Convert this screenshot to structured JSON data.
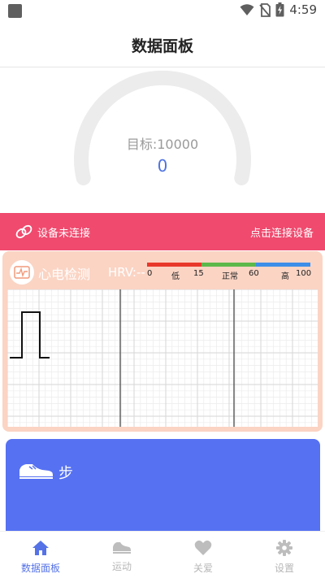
{
  "status_bar": {
    "time": "4:59"
  },
  "header": {
    "title": "数据面板"
  },
  "gauge": {
    "target_label": "目标:10000",
    "steps_value": "0",
    "progress": 0
  },
  "connect": {
    "status_text": "设备未连接",
    "action_text": "点击连接设备"
  },
  "ecg": {
    "title": "心电检测",
    "hrv_label": "HRV:--",
    "scale": [
      {
        "text": "0"
      },
      {
        "text": "低"
      },
      {
        "text": "15"
      },
      {
        "text": "正常"
      },
      {
        "text": "60"
      },
      {
        "text": "高"
      },
      {
        "text": "100"
      }
    ],
    "colors": {
      "low": "#e8382b",
      "normal": "#5cb84a",
      "high": "#3c8ee8"
    }
  },
  "steps_card": {
    "label": "步"
  },
  "nav": {
    "items": [
      {
        "label": "数据面板",
        "icon": "home-icon",
        "active": true
      },
      {
        "label": "运动",
        "icon": "shoe-icon",
        "active": false
      },
      {
        "label": "关爱",
        "icon": "heart-icon",
        "active": false
      },
      {
        "label": "设置",
        "icon": "gear-icon",
        "active": false
      }
    ]
  }
}
